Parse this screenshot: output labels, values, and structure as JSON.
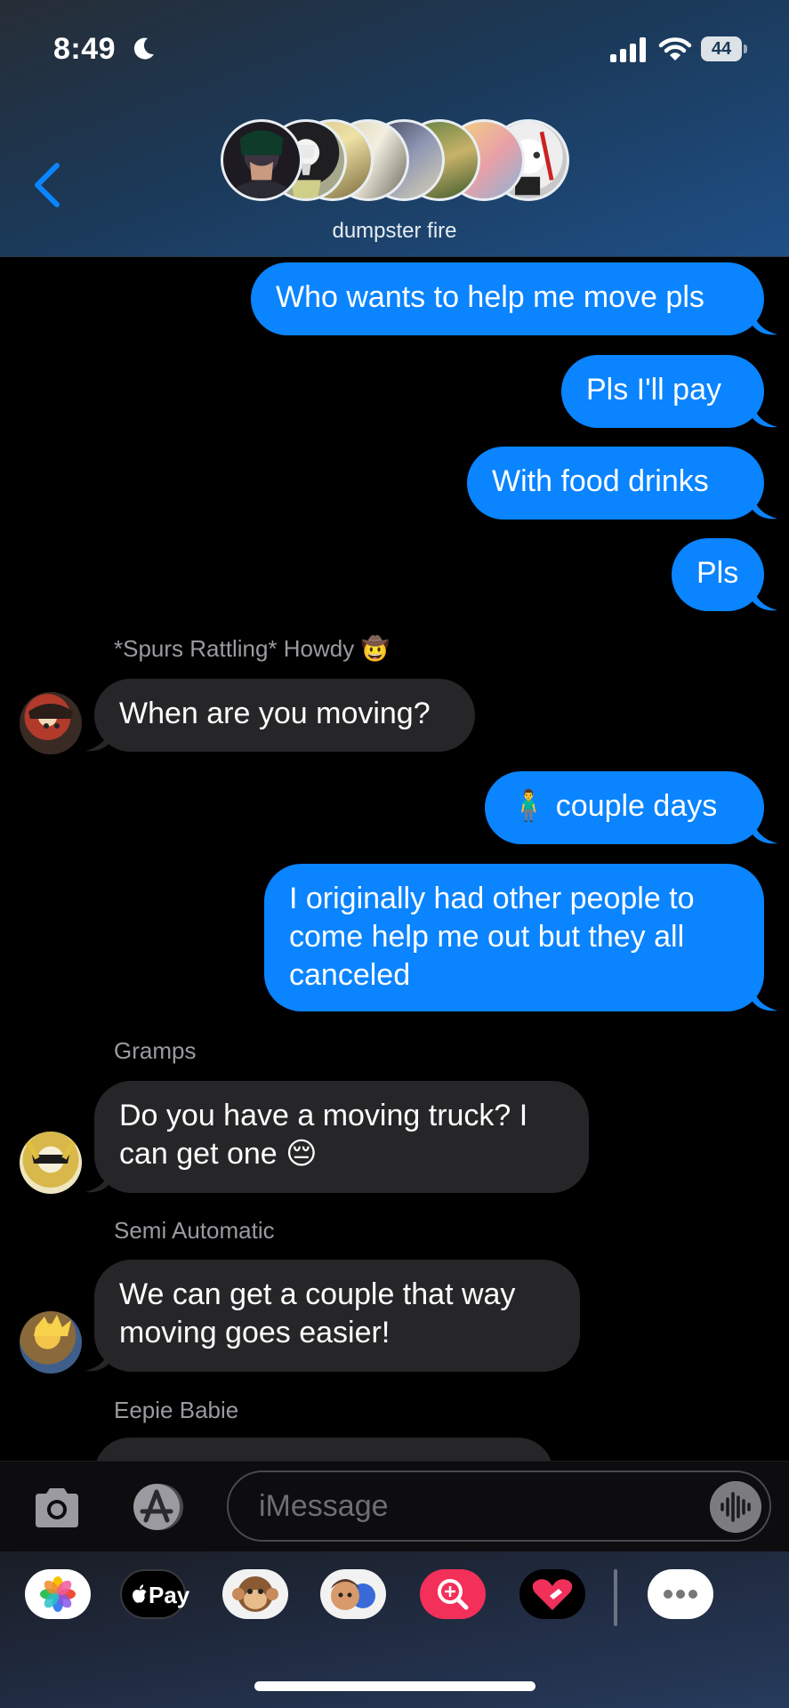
{
  "status_bar": {
    "time": "8:49",
    "battery": "44"
  },
  "header": {
    "group_name": "dumpster fire",
    "participants_icon": "stacked-avatars"
  },
  "messages": [
    {
      "type": "sent",
      "text": "Who wants to help me move pls"
    },
    {
      "type": "sent",
      "text": "Pls I'll pay"
    },
    {
      "type": "sent",
      "text": "With food drinks"
    },
    {
      "type": "sent",
      "text": "Pls"
    },
    {
      "type": "received",
      "sender": "*Spurs Rattling* Howdy 🤠",
      "text": "When are you moving?"
    },
    {
      "type": "sent",
      "text": "🧍‍♂️ couple days"
    },
    {
      "type": "sent",
      "text": "I originally had other people to come help me out but they all canceled"
    },
    {
      "type": "received",
      "sender": "Gramps",
      "text": "Do you have a moving truck? I can get one 😔"
    },
    {
      "type": "received",
      "sender": "Semi Automatic",
      "text": "We can get a couple that way moving goes easier!"
    },
    {
      "type": "received",
      "sender": "Eepie Babie",
      "text": ""
    }
  ],
  "composer": {
    "placeholder": "iMessage"
  },
  "app_drawer": {
    "apple_pay_label": "Pay",
    "items": [
      "photos-icon",
      "apple-pay-icon",
      "monkey-memoji-icon",
      "memoji-stickers-icon",
      "image-search-icon",
      "digital-touch-icon",
      "more-icon"
    ]
  },
  "colors": {
    "sent_bubble": "#0a84ff",
    "received_bubble": "#262628",
    "background": "#000000"
  }
}
